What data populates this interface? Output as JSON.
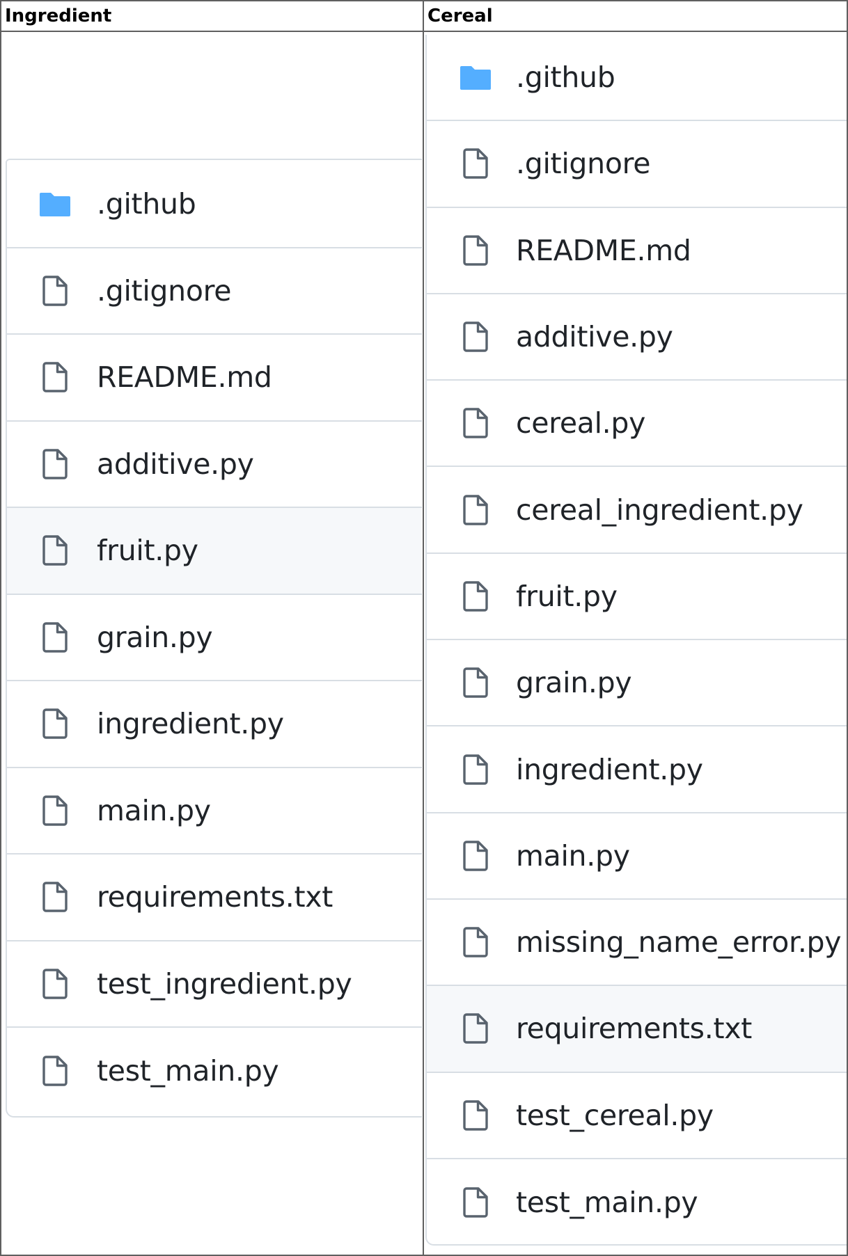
{
  "table": {
    "headers": [
      "Ingredient",
      "Cereal"
    ]
  },
  "ingredient_panel": {
    "items": [
      {
        "name": ".github",
        "type": "folder",
        "icon": "folder-icon"
      },
      {
        "name": ".gitignore",
        "type": "file",
        "icon": "file-icon"
      },
      {
        "name": "README.md",
        "type": "file",
        "icon": "file-icon"
      },
      {
        "name": "additive.py",
        "type": "file",
        "icon": "file-icon"
      },
      {
        "name": "fruit.py",
        "type": "file",
        "icon": "file-icon",
        "hovered": true
      },
      {
        "name": "grain.py",
        "type": "file",
        "icon": "file-icon"
      },
      {
        "name": "ingredient.py",
        "type": "file",
        "icon": "file-icon"
      },
      {
        "name": "main.py",
        "type": "file",
        "icon": "file-icon"
      },
      {
        "name": "requirements.txt",
        "type": "file",
        "icon": "file-icon"
      },
      {
        "name": "test_ingredient.py",
        "type": "file",
        "icon": "file-icon"
      },
      {
        "name": "test_main.py",
        "type": "file",
        "icon": "file-icon"
      }
    ]
  },
  "cereal_panel": {
    "items": [
      {
        "name": ".github",
        "type": "folder",
        "icon": "folder-icon"
      },
      {
        "name": ".gitignore",
        "type": "file",
        "icon": "file-icon"
      },
      {
        "name": "README.md",
        "type": "file",
        "icon": "file-icon"
      },
      {
        "name": "additive.py",
        "type": "file",
        "icon": "file-icon"
      },
      {
        "name": "cereal.py",
        "type": "file",
        "icon": "file-icon"
      },
      {
        "name": "cereal_ingredient.py",
        "type": "file",
        "icon": "file-icon"
      },
      {
        "name": "fruit.py",
        "type": "file",
        "icon": "file-icon"
      },
      {
        "name": "grain.py",
        "type": "file",
        "icon": "file-icon"
      },
      {
        "name": "ingredient.py",
        "type": "file",
        "icon": "file-icon"
      },
      {
        "name": "main.py",
        "type": "file",
        "icon": "file-icon"
      },
      {
        "name": "missing_name_error.py",
        "type": "file",
        "icon": "file-icon"
      },
      {
        "name": "requirements.txt",
        "type": "file",
        "icon": "file-icon",
        "hovered": true
      },
      {
        "name": "test_cereal.py",
        "type": "file",
        "icon": "file-icon"
      },
      {
        "name": "test_main.py",
        "type": "file",
        "icon": "file-icon"
      }
    ]
  },
  "colors": {
    "folder": "#54aeff",
    "file_icon": "#59636e",
    "text": "#1f2328",
    "row_border": "#d8dee4",
    "hover_bg": "#f6f8fa",
    "table_border": "#5f5f5f"
  }
}
